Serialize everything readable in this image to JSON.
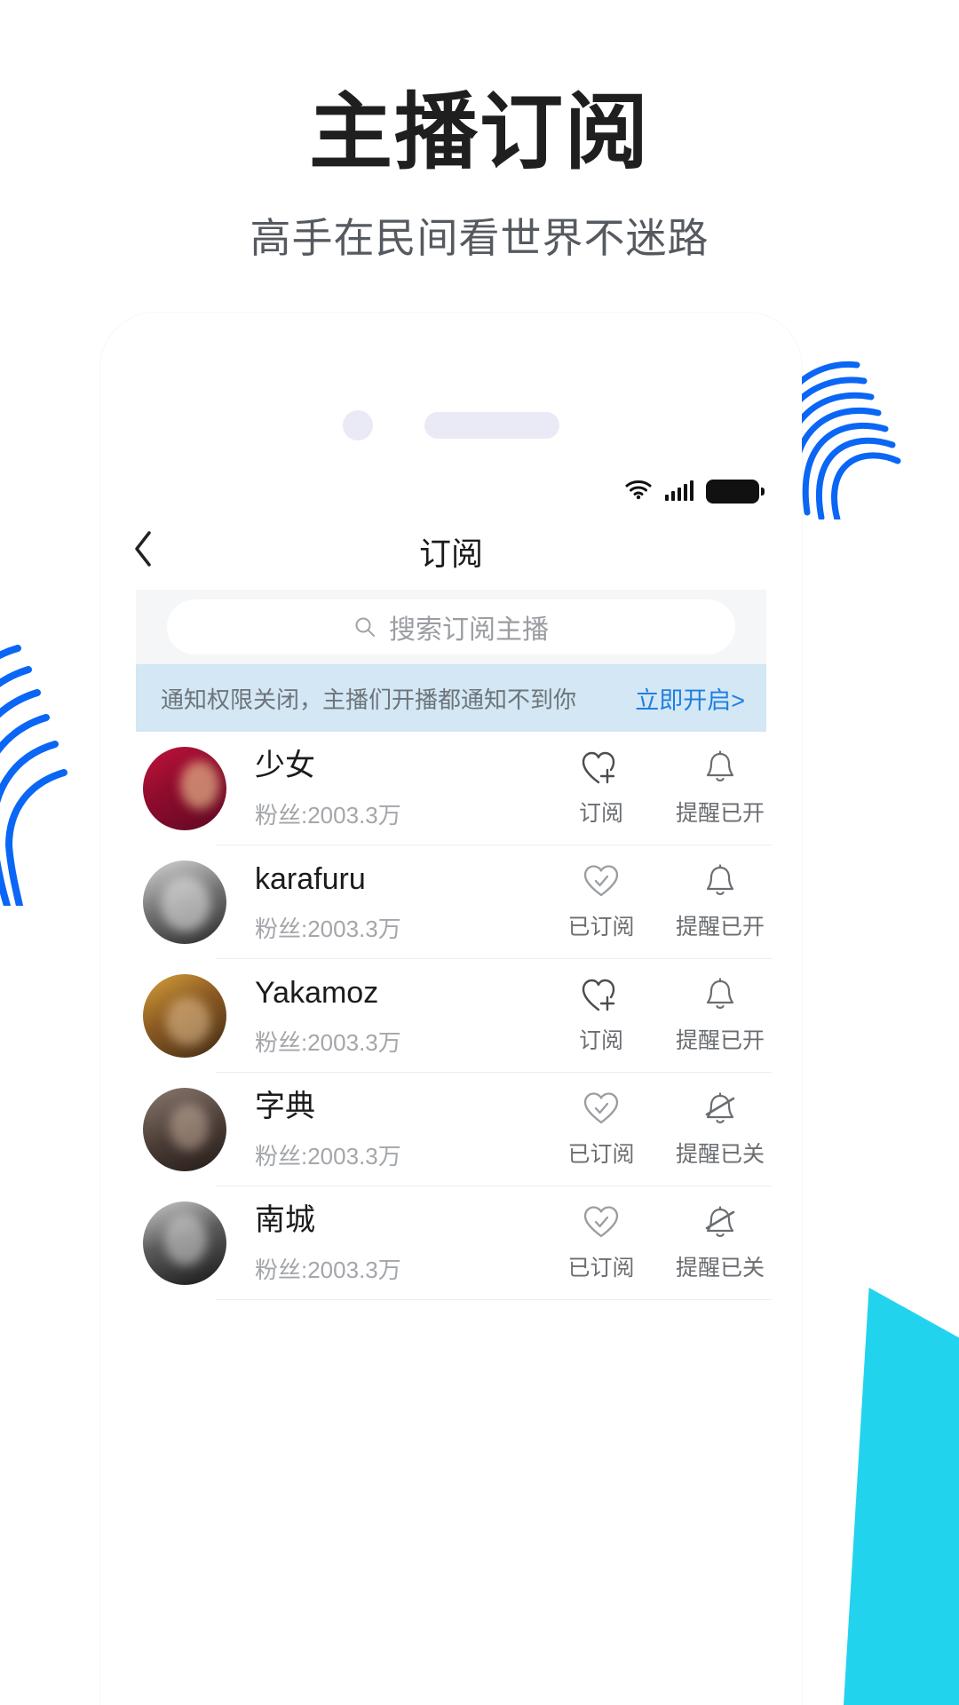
{
  "promo": {
    "title": "主播订阅",
    "subtitle": "高手在民间看世界不迷路"
  },
  "phone": {
    "statusbar": {
      "wifi_icon": "wifi-icon",
      "signal_icon": "cellular-signal-icon",
      "battery_icon": "battery-icon"
    },
    "navbar": {
      "back_icon": "chevron-left-icon",
      "title": "订阅"
    },
    "search": {
      "icon": "search-icon",
      "placeholder": "搜索订阅主播",
      "value": ""
    },
    "banner": {
      "message": "通知权限关闭，主播们开播都通知不到你",
      "action_label": "立即开启>",
      "bg_color": "#d3e7f5",
      "link_color": "#1f7fe0"
    },
    "list": [
      {
        "name": "少女",
        "fans": "粉丝:2003.3万",
        "avatar": "avatar-shaonv",
        "subscribe": {
          "label": "订阅",
          "icon": "heart-plus-icon",
          "state": "not-subscribed"
        },
        "remind": {
          "label": "提醒已开",
          "icon": "bell-icon",
          "state": "on"
        }
      },
      {
        "name": "karafuru",
        "fans": "粉丝:2003.3万",
        "avatar": "avatar-karafuru",
        "subscribe": {
          "label": "已订阅",
          "icon": "heart-check-icon",
          "state": "subscribed"
        },
        "remind": {
          "label": "提醒已开",
          "icon": "bell-icon",
          "state": "on"
        }
      },
      {
        "name": "Yakamoz",
        "fans": "粉丝:2003.3万",
        "avatar": "avatar-yakamoz",
        "subscribe": {
          "label": "订阅",
          "icon": "heart-plus-icon",
          "state": "not-subscribed"
        },
        "remind": {
          "label": "提醒已开",
          "icon": "bell-icon",
          "state": "on"
        }
      },
      {
        "name": "字典",
        "fans": "粉丝:2003.3万",
        "avatar": "avatar-zidian",
        "subscribe": {
          "label": "已订阅",
          "icon": "heart-check-icon",
          "state": "subscribed"
        },
        "remind": {
          "label": "提醒已关",
          "icon": "bell-slash-icon",
          "state": "off"
        }
      },
      {
        "name": "南城",
        "fans": "粉丝:2003.3万",
        "avatar": "avatar-nancheng",
        "subscribe": {
          "label": "已订阅",
          "icon": "heart-check-icon",
          "state": "subscribed"
        },
        "remind": {
          "label": "提醒已关",
          "icon": "bell-slash-icon",
          "state": "off"
        }
      }
    ]
  },
  "decoration": {
    "fingerprint_color": "#0a66f5",
    "accent_cyan": "#22d3ee"
  }
}
